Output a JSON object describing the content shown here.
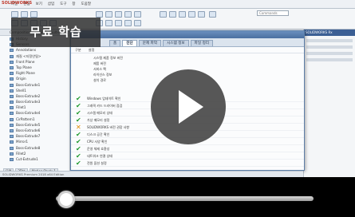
{
  "badge": {
    "label": "무료 학습"
  },
  "app": {
    "menu": [
      "파일",
      "편집",
      "보기",
      "삽입",
      "도구",
      "창",
      "도움말"
    ],
    "logo_text": "SOLIDWORKS",
    "search_placeholder": "Commands",
    "tree": {
      "header": "Composition Pres_B (Default<Disp",
      "items": [
        "History",
        "Sensors",
        "Annotations",
        "재질 <지정안됨>",
        "Front Plane",
        "Top Plane",
        "Right Plane",
        "Origin",
        "Boss-Extrude1",
        "Shell1",
        "Boss-Extrude2",
        "Boss-Extrude3",
        "Fillet1",
        "Boss-Extrude4",
        "CirPattern1",
        "Boss-Extrude5",
        "Boss-Extrude6",
        "Boss-Extrude7",
        "Mirror1",
        "Boss-Extrude8",
        "Fillet2",
        "Cut-Extrude1"
      ],
      "tabs": [
        "모델",
        "3D뷰",
        "Motion Study 1"
      ]
    },
    "right_panel_title": "SOLIDWORKS Rx",
    "dialog": {
      "tabs": [
        "홈",
        "진단",
        "문제 파악",
        "시스템 정보",
        "파일 정리"
      ],
      "active_tab": "진단",
      "subtabs": [
        "구분",
        "설정"
      ],
      "info_rows": [
        "시스템 제품 정보 버전",
        "제품 버전",
        "서비스 팩",
        "라이선스 정보",
        "설치 경로"
      ],
      "list": [
        {
          "status": "ok",
          "text": "Windows 업데이트 확인"
        },
        {
          "status": "ok",
          "text": "그래픽 카드 드라이버 점검"
        },
        {
          "status": "ok",
          "text": "시스템 메모리 상태"
        },
        {
          "status": "ok",
          "text": "가상 메모리 설정"
        },
        {
          "status": "warn",
          "text": "SOLIDWORKS 버전 권장 사항"
        },
        {
          "status": "ok",
          "text": "디스크 공간 확인"
        },
        {
          "status": "ok",
          "text": "CPU 사양 확인"
        },
        {
          "status": "ok",
          "text": "운영 체제 호환성"
        },
        {
          "status": "ok",
          "text": "네트워크 연결 상태"
        },
        {
          "status": "ok",
          "text": "전원 옵션 설정"
        }
      ]
    },
    "taskbar_text": "SOLIDWORKS Premium 2018 x64 Edition"
  },
  "player": {
    "progress": 0.04
  },
  "colors": {
    "check": "#1f9a2e",
    "warn": "#e08a00"
  }
}
